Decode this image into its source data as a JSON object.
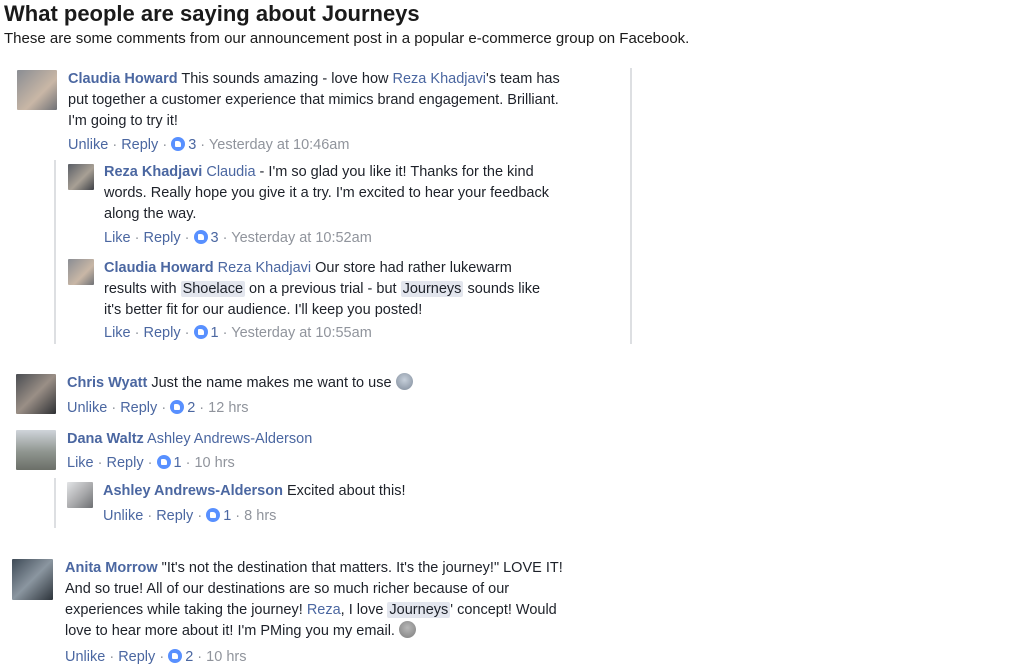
{
  "header": {
    "title": "What people are saying about Journeys",
    "subtitle": "These are some comments from our announcement post in a popular e-commerce group on Facebook."
  },
  "colors": {
    "link": "#4b67a1",
    "meta": "#90949c",
    "like": "#5890ff",
    "tag_bg": "#e3e6ee"
  },
  "comments": {
    "c1": {
      "author": "Claudia Howard",
      "line1": "This sounds amazing - love how ",
      "mention": "Reza Khadjavi",
      "line1b": "'s team has",
      "line2": "put together a customer experience that mimics brand engagement. Brilliant.",
      "line3": "I'm going to try it!",
      "action": "Unlike",
      "reply": "Reply",
      "likes": "3",
      "time": "Yesterday at 10:46am"
    },
    "r1": {
      "author": "Reza Khadjavi",
      "mention": "Claudia",
      "line1": " - I'm so glad you like it! Thanks for the kind",
      "line2": "words. Really hope you give it a try. I'm excited to hear your feedback",
      "line3": "along the way.",
      "action": "Like",
      "reply": "Reply",
      "likes": "3",
      "time": "Yesterday at 10:52am"
    },
    "r2": {
      "author": "Claudia Howard",
      "mention": "Reza Khadjavi",
      "line1": " Our store had rather lukewarm",
      "line2a": "results with ",
      "tag1": "Shoelace",
      "line2b": " on a previous trial - but ",
      "tag2": "Journeys",
      "line2c": " sounds like",
      "line3": "it's better fit for our audience. I'll keep you posted!",
      "action": "Like",
      "reply": "Reply",
      "likes": "1",
      "time": "Yesterday at 10:55am"
    },
    "c2": {
      "author": "Chris Wyatt",
      "line1": " Just the name makes me want to use",
      "action": "Unlike",
      "reply": "Reply",
      "likes": "2",
      "time": "12 hrs"
    },
    "c3": {
      "author": "Dana Waltz",
      "mention": "Ashley Andrews-Alderson",
      "action": "Like",
      "reply": "Reply",
      "likes": "1",
      "time": "10 hrs"
    },
    "r3": {
      "author": "Ashley Andrews-Alderson",
      "line1": " Excited about this!",
      "action": "Unlike",
      "reply": "Reply",
      "likes": "1",
      "time": "8 hrs"
    },
    "c4": {
      "author": "Anita Morrow",
      "line1": " \"It's not the destination that matters. It's the journey!\" LOVE IT!",
      "line2": "And so true! All of our destinations are so much richer because of our",
      "line3a": "experiences while taking the journey! ",
      "mention": "Reza",
      "line3b": ", I love ",
      "tag": "Journeys",
      "line3c": "' concept! Would",
      "line4": "love to hear more about it! I'm PMing you my email.",
      "action": "Unlike",
      "reply": "Reply",
      "likes": "2",
      "time": "10 hrs"
    }
  },
  "separator": "·"
}
